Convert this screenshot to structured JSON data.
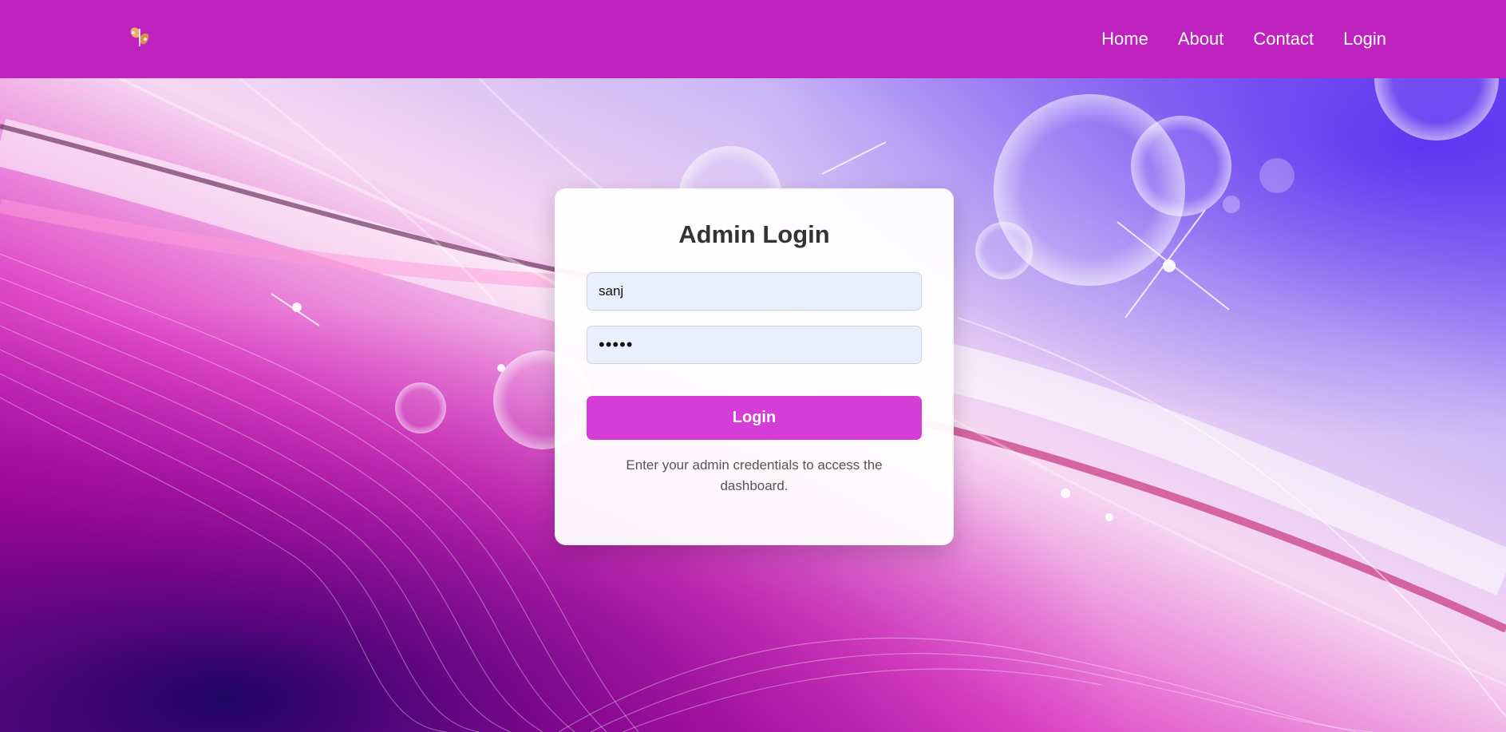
{
  "header": {
    "logo": "butterfly-logo",
    "nav": [
      "Home",
      "About",
      "Contact",
      "Login"
    ]
  },
  "login_card": {
    "title": "Admin Login",
    "username_value": "sanj",
    "password_value": "•••••",
    "button_label": "Login",
    "hint": "Enter your admin credentials to access the dashboard."
  },
  "colors": {
    "header_bg": "#bf22bf",
    "button_bg": "#d63cd6",
    "input_bg": "#e8f0fe"
  }
}
